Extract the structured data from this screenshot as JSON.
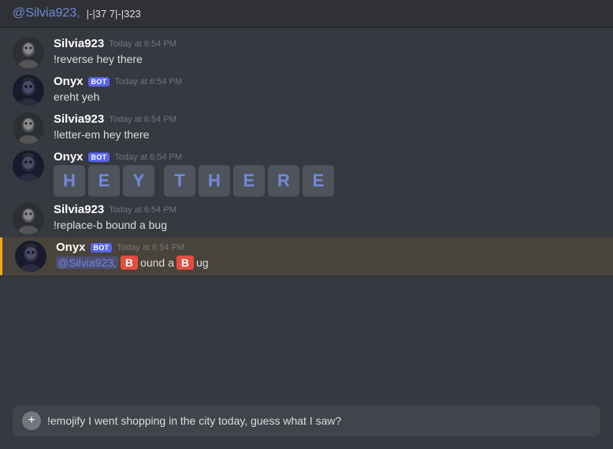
{
  "pinned": {
    "mention": "@Silvia923,",
    "text": " |-|37 7|-|323"
  },
  "messages": [
    {
      "id": "msg1",
      "username": "Silvia923",
      "userType": "human",
      "timestamp": "Today at 6:54 PM",
      "text": "!reverse hey there",
      "type": "text"
    },
    {
      "id": "msg2",
      "username": "Onyx",
      "userType": "bot",
      "timestamp": "Today at 6:54 PM",
      "text": "ereht yeh",
      "type": "text"
    },
    {
      "id": "msg3",
      "username": "Silvia923",
      "userType": "human",
      "timestamp": "Today at 6:54 PM",
      "text": "!letter-em hey there",
      "type": "text"
    },
    {
      "id": "msg4",
      "username": "Onyx",
      "userType": "bot",
      "timestamp": "Today at 6:54 PM",
      "type": "letter-boxes",
      "letters": [
        "H",
        "E",
        "Y",
        "T",
        "H",
        "E",
        "R",
        "E"
      ]
    },
    {
      "id": "msg5",
      "username": "Silvia923",
      "userType": "human",
      "timestamp": "Today at 6:54 PM",
      "text": "!replace-b bound a bug",
      "type": "text"
    },
    {
      "id": "msg6",
      "username": "Onyx",
      "userType": "bot",
      "timestamp": "Today at 6:54 PM",
      "type": "replace-b",
      "mention": "@Silvia923,",
      "parts": [
        {
          "type": "b-box",
          "text": "B"
        },
        {
          "type": "text",
          "text": "ound a "
        },
        {
          "type": "b-box",
          "text": "B"
        },
        {
          "type": "text",
          "text": "ug"
        }
      ],
      "highlighted": true
    }
  ],
  "input": {
    "placeholder": "!emojify I went shopping in the city today, guess what I saw?",
    "value": "!emojify I went shopping in the city today, guess what I saw?"
  },
  "labels": {
    "bot_badge": "BOT",
    "add_button": "+"
  }
}
